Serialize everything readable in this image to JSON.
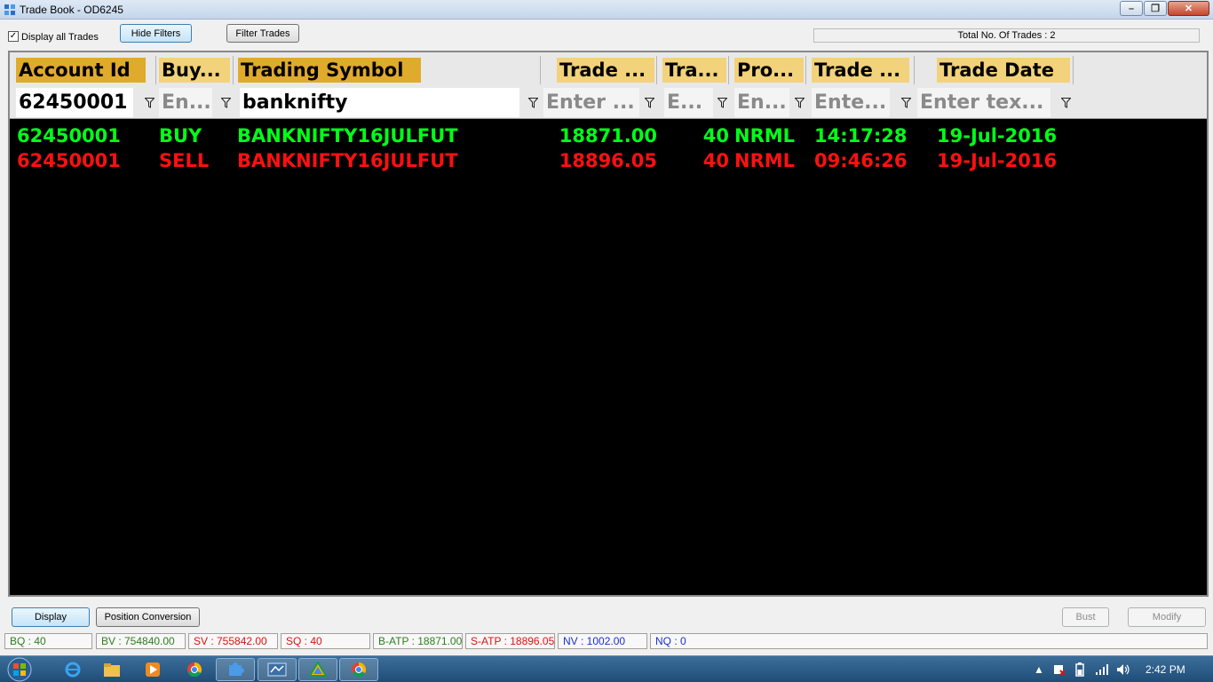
{
  "window": {
    "title": "Trade Book - OD6245"
  },
  "toolbar": {
    "display_all_label": "Display all Trades",
    "display_all_checked": true,
    "hide_filters": "Hide Filters",
    "filter_trades": "Filter Trades",
    "total_trades": "Total No. Of Trades : 2"
  },
  "grid": {
    "columns": [
      "Account Id",
      "Buy...",
      "Trading Symbol",
      "Trade ...",
      "Tra...",
      "Pro...",
      "Trade ...",
      "Trade Date"
    ],
    "filters": [
      {
        "value": "62450001",
        "placeholder": ""
      },
      {
        "value": "",
        "placeholder": "En..."
      },
      {
        "value": "banknifty",
        "placeholder": ""
      },
      {
        "value": "",
        "placeholder": "Enter ..."
      },
      {
        "value": "",
        "placeholder": "E..."
      },
      {
        "value": "",
        "placeholder": "En..."
      },
      {
        "value": "",
        "placeholder": "Ente..."
      },
      {
        "value": "",
        "placeholder": "Enter tex..."
      }
    ],
    "rows": [
      {
        "side": "buy",
        "cells": [
          "62450001",
          "BUY",
          "BANKNIFTY16JULFUT",
          "18871.00",
          "40",
          "NRML",
          "14:17:28",
          "19-Jul-2016"
        ]
      },
      {
        "side": "sell",
        "cells": [
          "62450001",
          "SELL",
          "BANKNIFTY16JULFUT",
          "18896.05",
          "40",
          "NRML",
          "09:46:26",
          "19-Jul-2016"
        ]
      }
    ]
  },
  "bottom": {
    "display": "Display",
    "position_conversion": "Position Conversion",
    "bust": "Bust",
    "modify": "Modify"
  },
  "status": {
    "bq": "BQ : 40",
    "bv": "BV : 754840.00",
    "sv": "SV : 755842.00",
    "sq": "SQ : 40",
    "batp": "B-ATP : 18871.00",
    "satp": "S-ATP : 18896.05",
    "nv": "NV : 1002.00",
    "nq": "NQ : 0"
  },
  "colors": {
    "buy": "#00ff1a",
    "sell": "#ff1010",
    "header": "#f2d27a",
    "header_active": "#e0aa2c"
  },
  "taskbar": {
    "clock": "2:42 PM"
  }
}
